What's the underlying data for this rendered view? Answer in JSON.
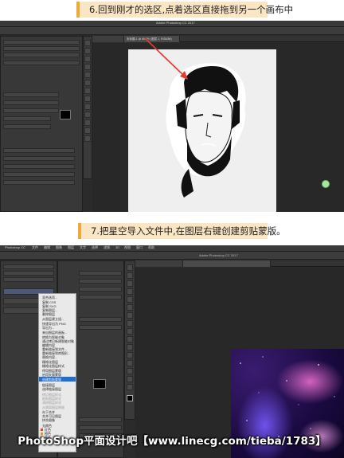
{
  "steps": [
    {
      "number": "6",
      "caption": "6.回到刚才的选区,点着选区直接拖到另一个画布中"
    },
    {
      "number": "7",
      "caption": "7.把星空导入文件中,在图层右键创建剪贴蒙版。"
    }
  ],
  "screenshot1": {
    "window_title": "Adobe Photoshop CC 2017",
    "active_tab": "未标题-1 @ 66.7% (图层 1, RGB/8#)",
    "accent": "#e53a2f"
  },
  "screenshot2": {
    "app_name": "Photoshop CC",
    "window_title": "Adobe Photoshop CC 2017",
    "menu_items": [
      "文件",
      "编辑",
      "图像",
      "图层",
      "文字",
      "选择",
      "滤镜",
      "3D",
      "视图",
      "窗口",
      "帮助"
    ],
    "context_menu": {
      "items": [
        "混合选项...",
        "复制 CSS",
        "复制 SVG",
        "复制图层...",
        "删除图层",
        "从图层建立组...",
        "快速导出为 PNG",
        "导出为...",
        "来自图层的画板...",
        "转换为智能对象",
        "通过拷贝新建智能对象",
        "编辑内容",
        "重新链接到文件...",
        "重新链接到库图形...",
        "替换内容...",
        "栅格化图层",
        "栅格化图层样式",
        "停用图层蒙版",
        "启用矢量蒙版",
        "创建剪贴蒙版",
        "链接图层",
        "选择链接图层",
        "拷贝图层样式",
        "粘贴图层样式",
        "清除图层样式",
        "从隔离图层释放",
        "向下合并",
        "合并可见图层",
        "拼合图像",
        "无颜色",
        "红色",
        "橙色",
        "黄色",
        "绿色"
      ],
      "highlighted": "创建剪贴蒙版",
      "highlight_color": "#1f6fd6"
    }
  },
  "watermark": "PhotoShop平面设计吧【www.linecg.com/tieba/1783】"
}
